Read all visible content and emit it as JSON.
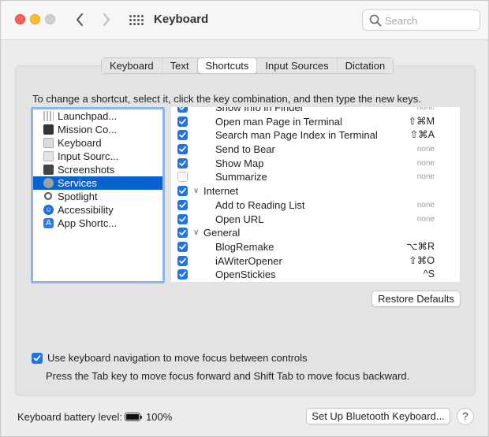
{
  "window": {
    "title": "Keyboard"
  },
  "search": {
    "placeholder": "Search"
  },
  "tabs": [
    {
      "label": "Keyboard",
      "active": false
    },
    {
      "label": "Text",
      "active": false
    },
    {
      "label": "Shortcuts",
      "active": true
    },
    {
      "label": "Input Sources",
      "active": false
    },
    {
      "label": "Dictation",
      "active": false
    }
  ],
  "instructions": "To change a shortcut, select it, click the key combination, and then type the new keys.",
  "categories": [
    {
      "label": "Launchpad...",
      "icon": "launchpad-icon"
    },
    {
      "label": "Mission Co...",
      "icon": "mission-control-icon"
    },
    {
      "label": "Keyboard",
      "icon": "keyboard-icon"
    },
    {
      "label": "Input Sourc...",
      "icon": "input-sources-icon"
    },
    {
      "label": "Screenshots",
      "icon": "screenshots-icon"
    },
    {
      "label": "Services",
      "icon": "services-gear-icon",
      "selected": true
    },
    {
      "label": "Spotlight",
      "icon": "spotlight-icon"
    },
    {
      "label": "Accessibility",
      "icon": "accessibility-icon"
    },
    {
      "label": "App Shortc...",
      "icon": "app-shortcuts-icon"
    }
  ],
  "shortcuts": [
    {
      "label": "Show Info in Finder",
      "key": "none",
      "checked": true,
      "partial": true
    },
    {
      "label": "Open man Page in Terminal",
      "key": "⇧⌘M",
      "checked": true
    },
    {
      "label": "Search man Page Index in Terminal",
      "key": "⇧⌘A",
      "checked": true
    },
    {
      "label": "Send to Bear",
      "key": "none",
      "checked": true
    },
    {
      "label": "Show Map",
      "key": "none",
      "checked": true
    },
    {
      "label": "Summarize",
      "key": "none",
      "checked": false
    },
    {
      "label": "Internet",
      "key": "",
      "checked": true,
      "group": true
    },
    {
      "label": "Add to Reading List",
      "key": "none",
      "checked": true
    },
    {
      "label": "Open URL",
      "key": "none",
      "checked": true
    },
    {
      "label": "General",
      "key": "",
      "checked": true,
      "group": true
    },
    {
      "label": "BlogRemake",
      "key": "⌥⌘R",
      "checked": true
    },
    {
      "label": "iAWiterOpener",
      "key": "⇧⌘O",
      "checked": true
    },
    {
      "label": "OpenStickies",
      "key": "^S",
      "checked": true
    }
  ],
  "restore_label": "Restore Defaults",
  "keyboard_nav": {
    "label": "Use keyboard navigation to move focus between controls",
    "checked": true,
    "hint": "Press the Tab key to move focus forward and Shift Tab to move focus backward."
  },
  "battery": {
    "label": "Keyboard battery level:",
    "value": "100%"
  },
  "bluetooth_label": "Set Up Bluetooth Keyboard...",
  "help_label": "?",
  "colors": {
    "accent": "#1f75e6",
    "selection": "#0a62d0"
  }
}
